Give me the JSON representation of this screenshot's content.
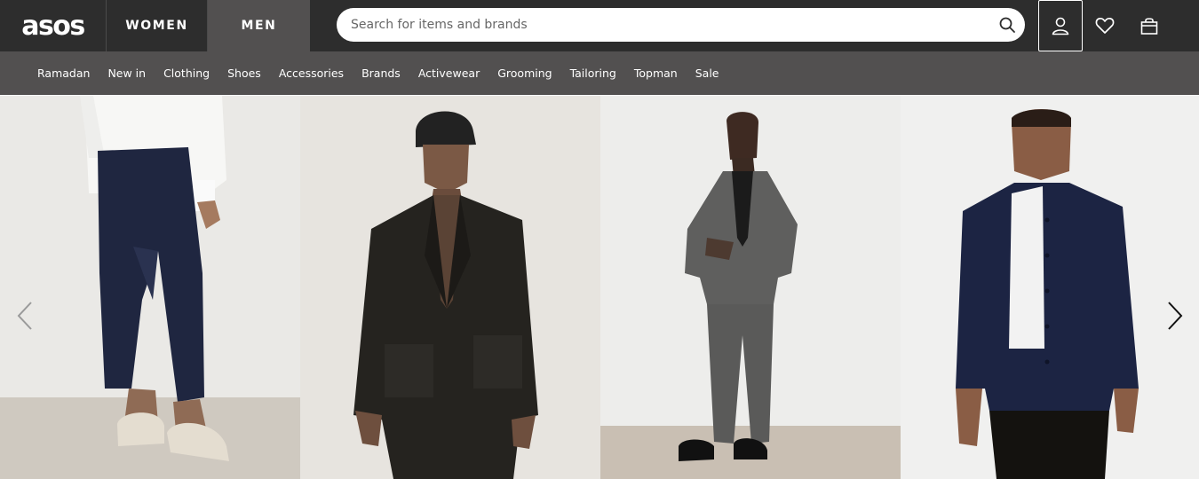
{
  "header": {
    "logo": "asos",
    "tabs": [
      {
        "label": "WOMEN",
        "active": false
      },
      {
        "label": "MEN",
        "active": true
      }
    ],
    "search": {
      "placeholder": "Search for items and brands",
      "value": ""
    },
    "icons": [
      "search-icon",
      "account-icon",
      "heart-icon",
      "bag-icon"
    ]
  },
  "nav": {
    "items": [
      "Ramadan",
      "New in",
      "Clothing",
      "Shoes",
      "Accessories",
      "Brands",
      "Activewear",
      "Grooming",
      "Tailoring",
      "Topman",
      "Sale"
    ]
  },
  "carousel": {
    "prev_icon": "chevron-left-icon",
    "next_icon": "chevron-right-icon"
  },
  "colors": {
    "header_bg": "#2d2d2d",
    "nav_bg": "#525050",
    "text": "#ffffff"
  }
}
